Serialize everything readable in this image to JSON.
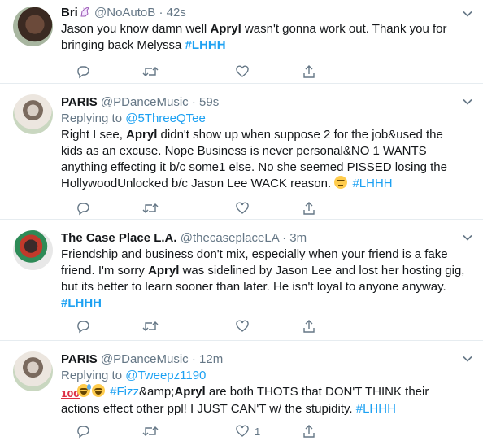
{
  "tweets": [
    {
      "name": "Bri",
      "handle": "@NoAutoB",
      "dot": "·",
      "time": "42s",
      "name_icon": "unicorn-icon",
      "segments": [
        {
          "t": "Jason you know damn well "
        },
        {
          "t": "Apryl",
          "b": true
        },
        {
          "t": " wasn't gonna work out. Thank you for bringing back Melyssa "
        },
        {
          "t": "#LHHH",
          "tag": true,
          "b": true
        }
      ],
      "reply_count": "",
      "retweet_count": "",
      "like_count": ""
    },
    {
      "name": "PARIS",
      "handle": "@PDanceMusic",
      "dot": "·",
      "time": "59s",
      "replying_prefix": "Replying to",
      "replying_to": "@5ThreeQTee",
      "segments": [
        {
          "t": "Right I see, "
        },
        {
          "t": "Apryl",
          "b": true
        },
        {
          "t": " didn't show up when suppose 2 for the job&used the kids as an excuse. Nope Business is never personal&NO 1 WANTS anything effecting it b/c some1 else. No she seemed PISSED losing the HollywoodUnlocked b/c Jason Lee WACK reason. "
        },
        {
          "e": "unamused-face-icon"
        },
        {
          "t": " "
        },
        {
          "t": "#LHHH",
          "tag": true
        }
      ],
      "reply_count": "",
      "retweet_count": "",
      "like_count": ""
    },
    {
      "name": "The Case Place L.A.",
      "handle": "@thecaseplaceLA",
      "dot": "·",
      "time": "3m",
      "segments": [
        {
          "t": "Friendship and business don't mix, especially when your friend is a fake friend. I'm sorry "
        },
        {
          "t": "Apryl",
          "b": true
        },
        {
          "t": " was sidelined by Jason Lee and lost her hosting gig, but its better to learn sooner than later. He isn't loyal to anyone anyway. "
        },
        {
          "t": "#LHHH",
          "tag": true,
          "b": true
        }
      ],
      "reply_count": "",
      "retweet_count": "",
      "like_count": ""
    },
    {
      "name": "PARIS",
      "handle": "@PDanceMusic",
      "dot": "·",
      "time": "12m",
      "replying_prefix": "Replying to",
      "replying_to": "@Tweepz1190",
      "segments": [
        {
          "e": "hundred-points-icon"
        },
        {
          "e": "grinning-sweat-icon"
        },
        {
          "e": "grinning-face-icon"
        },
        {
          "t": " "
        },
        {
          "t": "#Fizz",
          "tag": true
        },
        {
          "t": "&amp;"
        },
        {
          "t": "Apryl",
          "b": true
        },
        {
          "t": " are both THOTS that DON'T THINK their actions effect other ppl! I JUST CAN'T w/ the stupidity. "
        },
        {
          "t": "#LHHH",
          "tag": true
        }
      ],
      "reply_count": "",
      "retweet_count": "",
      "like_count": "1"
    }
  ],
  "icons": {
    "reply": "reply-icon",
    "retweet": "retweet-icon",
    "like": "heart-icon",
    "share": "share-icon",
    "caret": "chevron-down-icon"
  },
  "colors": {
    "link": "#1da1f2",
    "muted": "#657786",
    "text": "#14171a",
    "divider": "#e6ecf0"
  }
}
